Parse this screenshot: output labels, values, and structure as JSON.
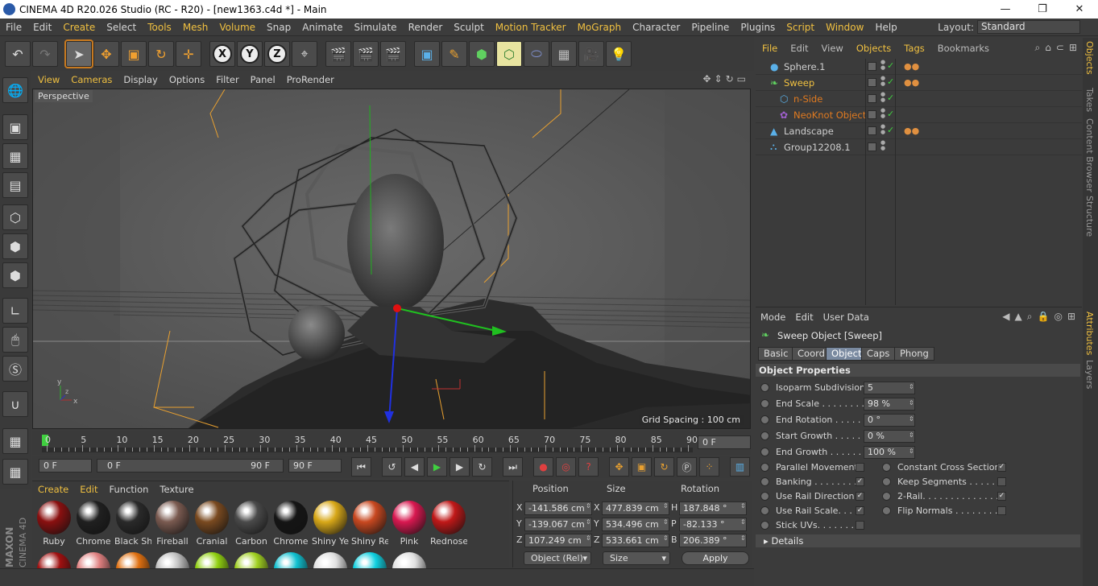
{
  "window": {
    "title": "CINEMA 4D R20.026 Studio (RC - R20) - [new1363.c4d *] - Main",
    "minimize": "—",
    "maximize": "❐",
    "close": "✕"
  },
  "menu": [
    "File",
    "Edit",
    "Create",
    "Select",
    "Tools",
    "Mesh",
    "Volume",
    "Snap",
    "Animate",
    "Simulate",
    "Render",
    "Sculpt",
    "Motion Tracker",
    "MoGraph",
    "Character",
    "Pipeline",
    "Plugins",
    "Script",
    "Window",
    "Help"
  ],
  "menu_highlight": [
    "Create",
    "Tools",
    "Mesh",
    "Volume",
    "Motion Tracker",
    "MoGraph",
    "Script",
    "Window"
  ],
  "layout": {
    "label": "Layout:",
    "value": "Standard"
  },
  "toolbar": {
    "x_axis": "X",
    "y_axis": "Y",
    "z_axis": "Z"
  },
  "viewport": {
    "menu": [
      "View",
      "Cameras",
      "Display",
      "Options",
      "Filter",
      "Panel",
      "ProRender"
    ],
    "menu_highlight": [
      "View",
      "Cameras"
    ],
    "camera_label": "Perspective",
    "grid_spacing": "Grid Spacing : 100 cm"
  },
  "timeline": {
    "ticks": [
      "0",
      "5",
      "10",
      "15",
      "20",
      "25",
      "30",
      "35",
      "40",
      "45",
      "50",
      "55",
      "60",
      "65",
      "70",
      "75",
      "80",
      "85",
      "90"
    ],
    "current_frame": "0 F",
    "start_field": "0 F",
    "range_start": "0 F",
    "range_end": "90 F",
    "end_field": "90 F"
  },
  "materials": {
    "menu": [
      "Create",
      "Edit",
      "Function",
      "Texture"
    ],
    "menu_highlight": [
      "Create",
      "Edit"
    ],
    "items": [
      {
        "name": "Ruby",
        "color": "#8a1010"
      },
      {
        "name": "Chrome",
        "color": "#202020"
      },
      {
        "name": "Black Sh",
        "color": "#2a2a2a"
      },
      {
        "name": "Fireball",
        "color": "#7a5a50"
      },
      {
        "name": "Cranial",
        "color": "#7a4a20"
      },
      {
        "name": "Carbon",
        "color": "#4a4a4a"
      },
      {
        "name": "Chrome",
        "color": "#151515"
      },
      {
        "name": "Shiny Ye",
        "color": "#d8a818"
      },
      {
        "name": "Shiny Re",
        "color": "#c84820"
      },
      {
        "name": "Pink",
        "color": "#d81850"
      },
      {
        "name": "Rednose",
        "color": "#c01818"
      }
    ],
    "row2_colors": [
      "#a01010",
      "#e08080",
      "#e07010",
      "#c0c0c0",
      "#90d010",
      "#a0d020",
      "#10c0d0",
      "#e0e0e0",
      "#10d0e0",
      "#e0e0e0"
    ]
  },
  "coords": {
    "headers": {
      "position": "Position",
      "size": "Size",
      "rotation": "Rotation"
    },
    "rows": [
      {
        "axis": "X",
        "pos": "-141.586 cm",
        "saxis": "X",
        "size": "477.839 cm",
        "raxis": "H",
        "rot": "187.848 °"
      },
      {
        "axis": "Y",
        "pos": "-139.067 cm",
        "saxis": "Y",
        "size": "534.496 cm",
        "raxis": "P",
        "rot": "-82.133 °"
      },
      {
        "axis": "Z",
        "pos": "107.249 cm",
        "saxis": "Z",
        "size": "533.661 cm",
        "raxis": "B",
        "rot": "206.389 °"
      }
    ],
    "mode_dropdown": "Object (Rel)",
    "size_dropdown": "Size",
    "apply": "Apply"
  },
  "objects": {
    "menu": [
      "File",
      "Edit",
      "View",
      "Objects",
      "Tags",
      "Bookmarks"
    ],
    "menu_highlight": [
      "File",
      "Objects",
      "Tags"
    ],
    "rows": [
      {
        "name": "Sphere.1",
        "color": "#cfcfcf",
        "indent": 0,
        "check": "✓",
        "tag": "●●"
      },
      {
        "name": "Sweep",
        "color": "#f0c040",
        "indent": 0,
        "check": "✓",
        "tag": "●●"
      },
      {
        "name": "n-Side",
        "color": "#e07a20",
        "indent": 1,
        "check": "✓",
        "tag": ""
      },
      {
        "name": "NeoKnot Object",
        "color": "#e07a20",
        "indent": 1,
        "check": "✓",
        "tag": ""
      },
      {
        "name": "Landscape",
        "color": "#cfcfcf",
        "indent": 0,
        "check": "✓",
        "tag": "●●"
      },
      {
        "name": "Group12208.1",
        "color": "#cfcfcf",
        "indent": 0,
        "check": "",
        "tag": ""
      }
    ]
  },
  "right_tabs": [
    "Objects",
    "Takes",
    "Content Browser",
    "Structure",
    "Attributes",
    "Layers"
  ],
  "attributes": {
    "menu": [
      "Mode",
      "Edit",
      "User Data"
    ],
    "title": "Sweep Object [Sweep]",
    "tabs": [
      "Basic",
      "Coord.",
      "Object",
      "Caps",
      "Phong"
    ],
    "active_tab": "Object",
    "section": "Object Properties",
    "fields": [
      {
        "label": "Isoparm Subdivision",
        "value": "5"
      },
      {
        "label": "End Scale . . . . . . . . .",
        "value": "98 %"
      },
      {
        "label": "End Rotation . . . . . .",
        "value": "0 °"
      },
      {
        "label": "Start Growth . . . . . .",
        "value": "0 %"
      },
      {
        "label": "End Growth . . . . . . .",
        "value": "100 %"
      }
    ],
    "checks_left": [
      {
        "label": "Parallel Movement",
        "checked": false,
        "mark": ""
      },
      {
        "label": "Banking . . . . . . . . .",
        "checked": true,
        "mark": "✓"
      },
      {
        "label": "Use Rail Direction",
        "checked": true,
        "mark": "✓"
      },
      {
        "label": "Use Rail Scale. . . .",
        "checked": true,
        "mark": "✓"
      },
      {
        "label": "Stick UVs. . . . . . . .",
        "checked": false,
        "mark": ""
      }
    ],
    "checks_right": [
      {
        "label": "Constant Cross Section",
        "checked": true,
        "mark": "✓"
      },
      {
        "label": "Keep Segments . . . . . .",
        "checked": false,
        "mark": ""
      },
      {
        "label": "2-Rail. . . . . . . . . . . . . .",
        "checked": true,
        "mark": "✓"
      },
      {
        "label": "Flip Normals . . . . . . . . .",
        "checked": false,
        "mark": ""
      }
    ],
    "details": "Details"
  },
  "branding": {
    "maxon": "MAXON",
    "product": "CINEMA 4D"
  }
}
